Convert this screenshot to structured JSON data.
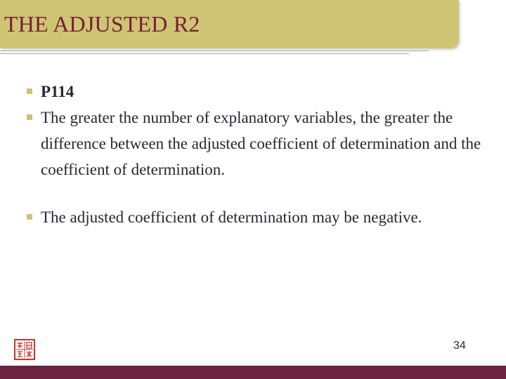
{
  "slide": {
    "title": "THE ADJUSTED R2",
    "bullets": [
      {
        "text": "P114"
      },
      {
        "text": "The greater the number of explanatory variables, the greater the difference between the adjusted coefficient of determination and the coefficient of determination."
      },
      {
        "text": "The adjusted coefficient of determination may be negative."
      }
    ],
    "slide_number": "34"
  },
  "colors": {
    "title_bar": "#cdc574",
    "title_text": "#7a1d35",
    "footer_bar": "#6b2340",
    "seal": "#c8342f"
  },
  "icons": {
    "bullet": "square-bullet-icon",
    "seal": "seal-stamp-icon"
  }
}
